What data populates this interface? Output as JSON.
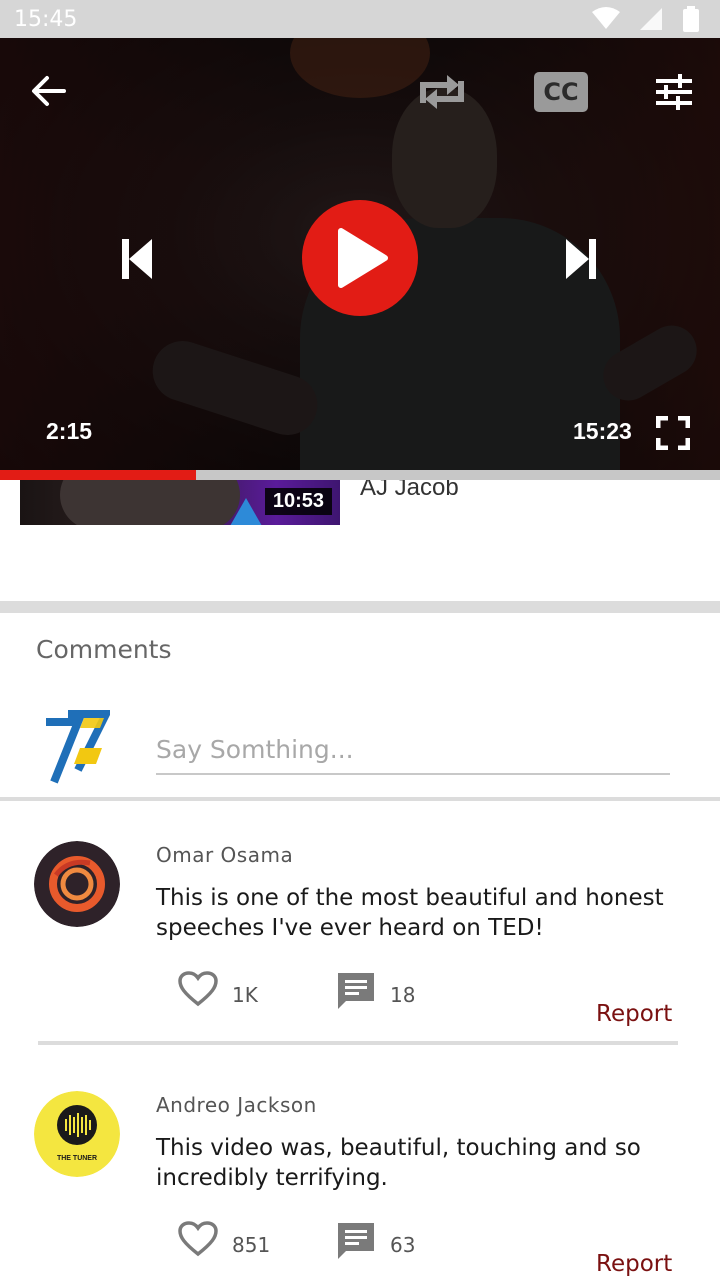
{
  "status_bar": {
    "time": "15:45",
    "icons": [
      "wifi-icon",
      "signal-icon",
      "battery-icon"
    ]
  },
  "player": {
    "current_time": "2:15",
    "total_time": "15:23",
    "progress": 0.272,
    "cc_label": "CC",
    "accent_color": "#e21c15",
    "icons": [
      "back-arrow-icon",
      "repeat-icon",
      "cc-icon",
      "tune-icon",
      "skip-previous-icon",
      "play-icon",
      "skip-next-icon",
      "fullscreen-icon"
    ]
  },
  "up_next": {
    "duration": "10:53",
    "author": "AJ Jacob"
  },
  "comments": {
    "title": "Comments",
    "input_placeholder": "Say Somthing...",
    "report_label": "Report",
    "report_color": "#7a1010",
    "items": [
      {
        "author": "Omar Osama",
        "text": "This is one of the most beautiful and honest speeches I've ever heard on TED!",
        "likes": "1K",
        "replies": "18"
      },
      {
        "author": "Andreo Jackson",
        "text": "This video was, beautiful, touching and so incredibly terrifying.",
        "likes": "851",
        "replies": "63",
        "avatar_text": "THE TUNER"
      }
    ]
  }
}
